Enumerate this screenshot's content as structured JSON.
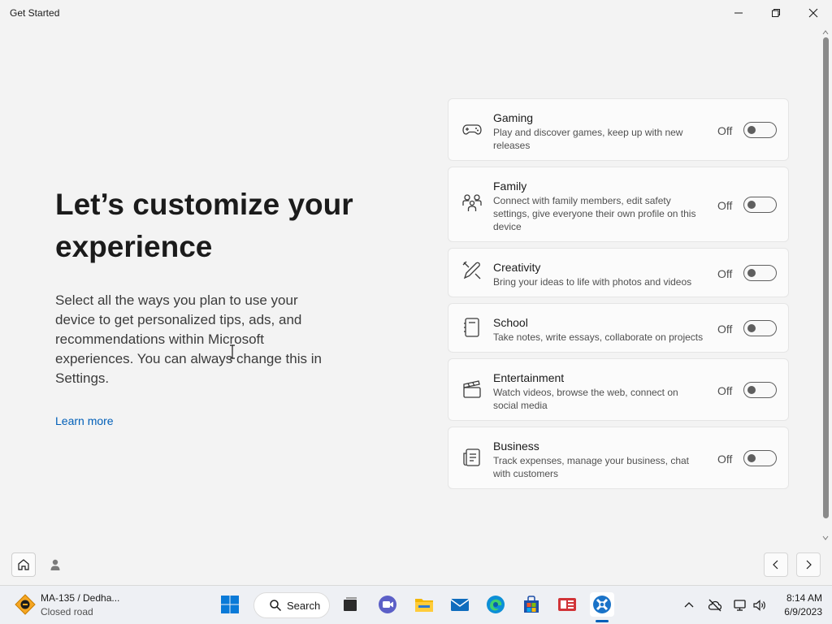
{
  "window": {
    "title": "Get Started"
  },
  "main": {
    "headline": "Let’s customize your experience",
    "description": "Select all the ways you plan to use your device to get personalized tips, ads, and recommendations within Microsoft experiences. You can always change this in Settings.",
    "learn_more": "Learn more"
  },
  "categories": [
    {
      "title": "Gaming",
      "description": "Play and discover games, keep up with new releases",
      "state": "Off",
      "icon": "gamepad-icon"
    },
    {
      "title": "Family",
      "description": "Connect with family members, edit safety settings, give everyone their own profile on this device",
      "state": "Off",
      "icon": "family-icon"
    },
    {
      "title": "Creativity",
      "description": "Bring your ideas to life with photos and videos",
      "state": "Off",
      "icon": "pen-brush-icon"
    },
    {
      "title": "School",
      "description": "Take notes, write essays, collaborate on projects",
      "state": "Off",
      "icon": "notebook-icon"
    },
    {
      "title": "Entertainment",
      "description": "Watch videos, browse the web, connect on social media",
      "state": "Off",
      "icon": "clapperboard-icon"
    },
    {
      "title": "Business",
      "description": "Track expenses, manage your business, chat with customers",
      "state": "Off",
      "icon": "document-icon"
    }
  ],
  "taskbar": {
    "weather_title": "MA-135 / Dedha...",
    "weather_sub": "Closed road",
    "search_label": "Search",
    "time": "8:14 AM",
    "date": "6/9/2023"
  },
  "colors": {
    "accent": "#005fb8",
    "background": "#f3f3f3",
    "card": "#fbfbfb"
  }
}
